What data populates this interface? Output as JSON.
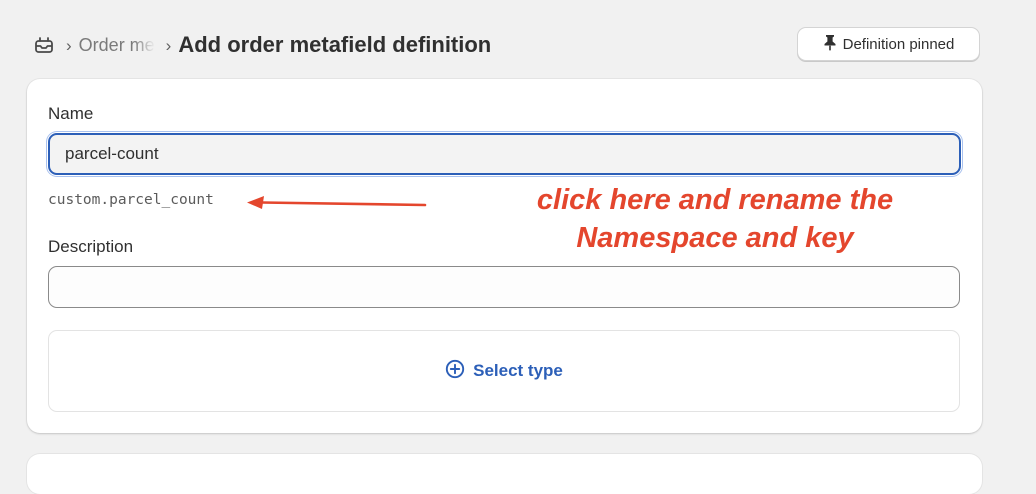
{
  "breadcrumb": {
    "icon": "orders-icon",
    "parent_label": "Order metafield definitions",
    "title": "Add order metafield definition"
  },
  "pin_button": {
    "label": "Definition pinned",
    "icon": "pin-icon"
  },
  "form": {
    "name_label": "Name",
    "name_value": "parcel-count",
    "namespace_key": "custom.parcel_count",
    "description_label": "Description",
    "description_value": "",
    "select_type_label": "Select type"
  },
  "annotation": {
    "line1": "click here and rename the",
    "line2": "Namespace and key",
    "color": "#e4462d"
  },
  "colors": {
    "accent": "#2c5fb8",
    "background": "#f1f1f1"
  }
}
